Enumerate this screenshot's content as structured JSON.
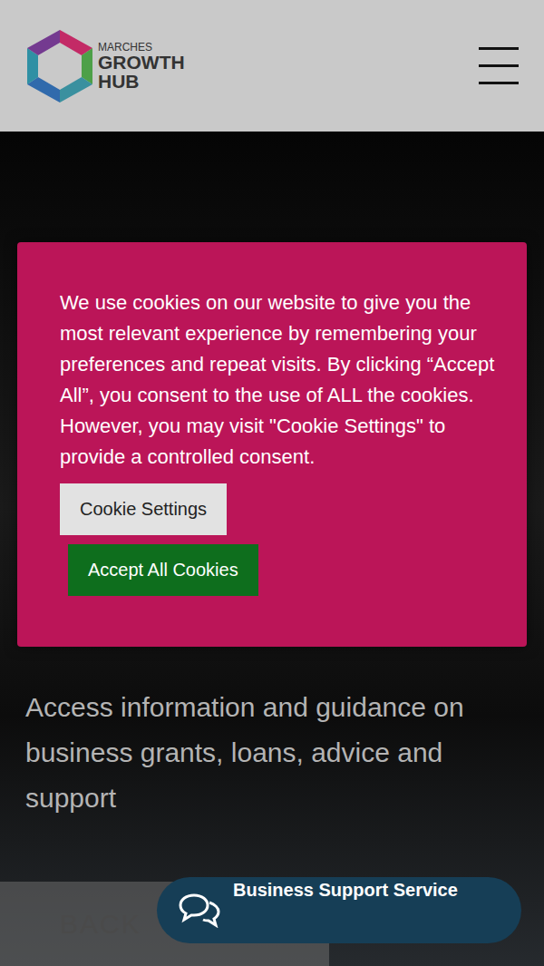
{
  "header": {
    "logo": {
      "line1": "MARCHES",
      "line2": "GROWTH",
      "line3": "HUB"
    }
  },
  "cookie_banner": {
    "message": "We use cookies on our website to give you the most relevant experience by remembering your preferences and repeat visits. By clicking “Accept All”, you consent to the use of ALL the cookies. However, you may visit \"Cookie Settings\" to provide a controlled consent.",
    "buttons": [
      {
        "label": "Cookie Settings",
        "kind": "secondary"
      },
      {
        "label": "Accept All Cookies",
        "kind": "primary"
      }
    ]
  },
  "hero": {
    "text": "Access information and guidance on business grants, loans, advice and support"
  },
  "back_button": {
    "label": "BACK"
  },
  "chat": {
    "label": "Business Support Service"
  }
}
